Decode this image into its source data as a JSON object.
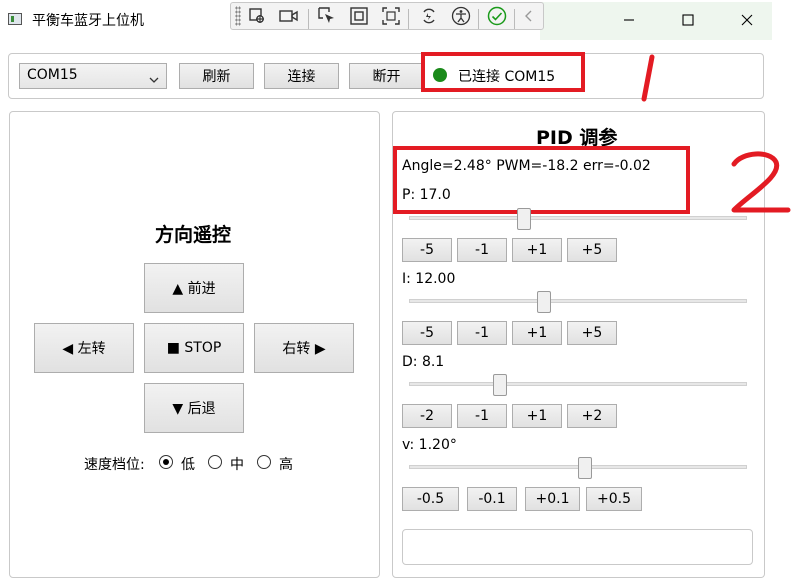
{
  "window": {
    "title": "平衡车蓝牙上位机",
    "minimize_glyph": "—",
    "maximize_glyph": "☐",
    "close_glyph": "✕"
  },
  "dev_toolbar": {
    "icons": [
      "select-element-icon",
      "video-icon",
      "pointer-icon",
      "frame-icon",
      "scan-icon",
      "hot-reload-icon",
      "accessibility-icon",
      "check-icon",
      "collapse-chevron-icon"
    ]
  },
  "connection": {
    "port_selected": "COM15",
    "refresh_label": "刷新",
    "connect_label": "连接",
    "disconnect_label": "断开",
    "status_text": "已连接 COM15",
    "status_color": "#1a8a1a"
  },
  "direction": {
    "title": "方向遥控",
    "forward_label": "▲ 前进",
    "left_label": "◀ 左转",
    "stop_label": "■ STOP",
    "right_label": "右转 ▶",
    "back_label": "▼ 后退",
    "speed_label": "速度档位:",
    "speed_options": [
      "低",
      "中",
      "高"
    ],
    "speed_selected": "低"
  },
  "pid": {
    "title": "PID 调参",
    "telemetry": "Angle=2.48°  PWM=-18.2  err=-0.02",
    "p": {
      "label": "P: 17.0",
      "slider_fraction": 0.34,
      "buttons": [
        "-5",
        "-1",
        "+1",
        "+5"
      ]
    },
    "i": {
      "label": "I: 12.00",
      "slider_fraction": 0.4,
      "buttons": [
        "-5",
        "-1",
        "+1",
        "+5"
      ]
    },
    "d": {
      "label": "D: 8.1",
      "slider_fraction": 0.27,
      "buttons": [
        "-2",
        "-1",
        "+1",
        "+2"
      ]
    },
    "v": {
      "label": "v: 1.20°",
      "slider_fraction": 0.52,
      "buttons": [
        "-0.5",
        "-0.1",
        "+0.1",
        "+0.5"
      ]
    }
  },
  "annotations": {
    "one": "1",
    "two": "2",
    "color": "#e31b23"
  }
}
